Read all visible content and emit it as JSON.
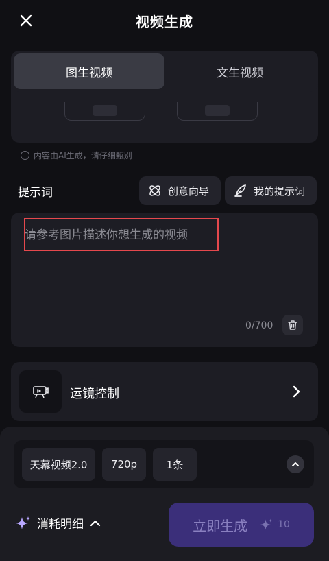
{
  "header": {
    "title": "视频生成"
  },
  "tabs": [
    {
      "label": "图生视频",
      "active": true
    },
    {
      "label": "文生视频",
      "active": false
    }
  ],
  "disclaimer": "内容由AI生成，请仔细甄别",
  "prompt": {
    "label": "提示词",
    "placeholder": "请参考图片描述你想生成的视频",
    "value": "",
    "counter": "0/700"
  },
  "chips": {
    "creative_guide": "创意向导",
    "my_prompts": "我的提示词"
  },
  "camera_control": {
    "label": "运镜控制"
  },
  "settings": {
    "model": "天幕视频2.0",
    "resolution": "720p",
    "count": "1条"
  },
  "footer": {
    "cost_detail_label": "消耗明细",
    "generate_label": "立即生成",
    "generate_cost": "10"
  },
  "colors": {
    "background": "#101014",
    "card": "#1d1d24",
    "highlight_border": "#e5484d",
    "generate_button": "#3b2f7a"
  },
  "icons": [
    "close-icon",
    "info-icon",
    "creative-guide-icon",
    "feather-pen-icon",
    "trash-icon",
    "camera-control-icon",
    "chevron-right-icon",
    "chevron-up-icon",
    "sparkle-icon"
  ]
}
